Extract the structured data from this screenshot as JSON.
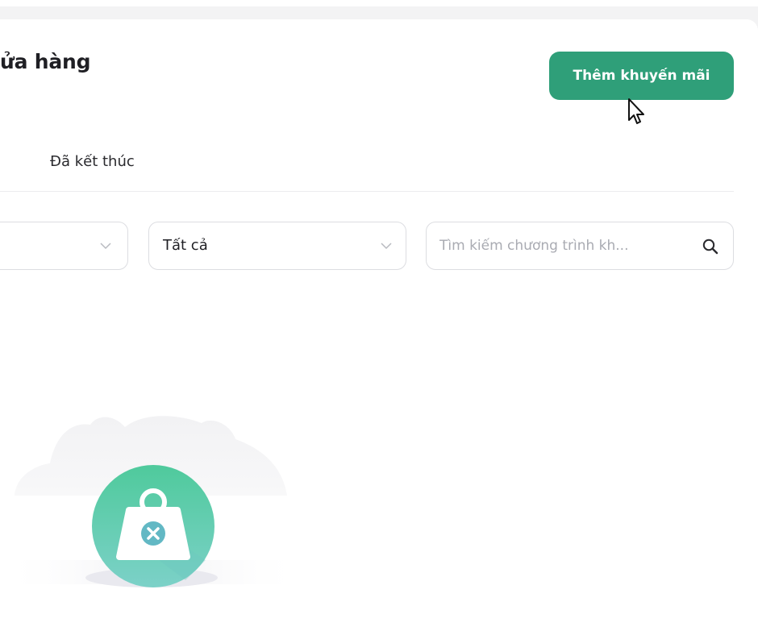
{
  "page": {
    "title": "ửa hàng",
    "add_button_label": "Thêm khuyến mãi"
  },
  "tabs": [
    {
      "label": "Đã kết thúc"
    }
  ],
  "filters": {
    "first_select_value": "",
    "second_select_value": "Tất cả"
  },
  "search": {
    "placeholder": "Tìm kiếm chương trình kh...",
    "value": ""
  },
  "empty_state": {
    "message": "· · · · · ·"
  },
  "colors": {
    "accent": "#2f9f79",
    "illustration_green": "#4fca9c",
    "illustration_teal": "#7cd1c8"
  },
  "icons": {
    "search": "search-icon",
    "dropdown": "chevron-down-icon",
    "empty": "empty-weight-icon",
    "cursor": "mouse-cursor-icon"
  }
}
